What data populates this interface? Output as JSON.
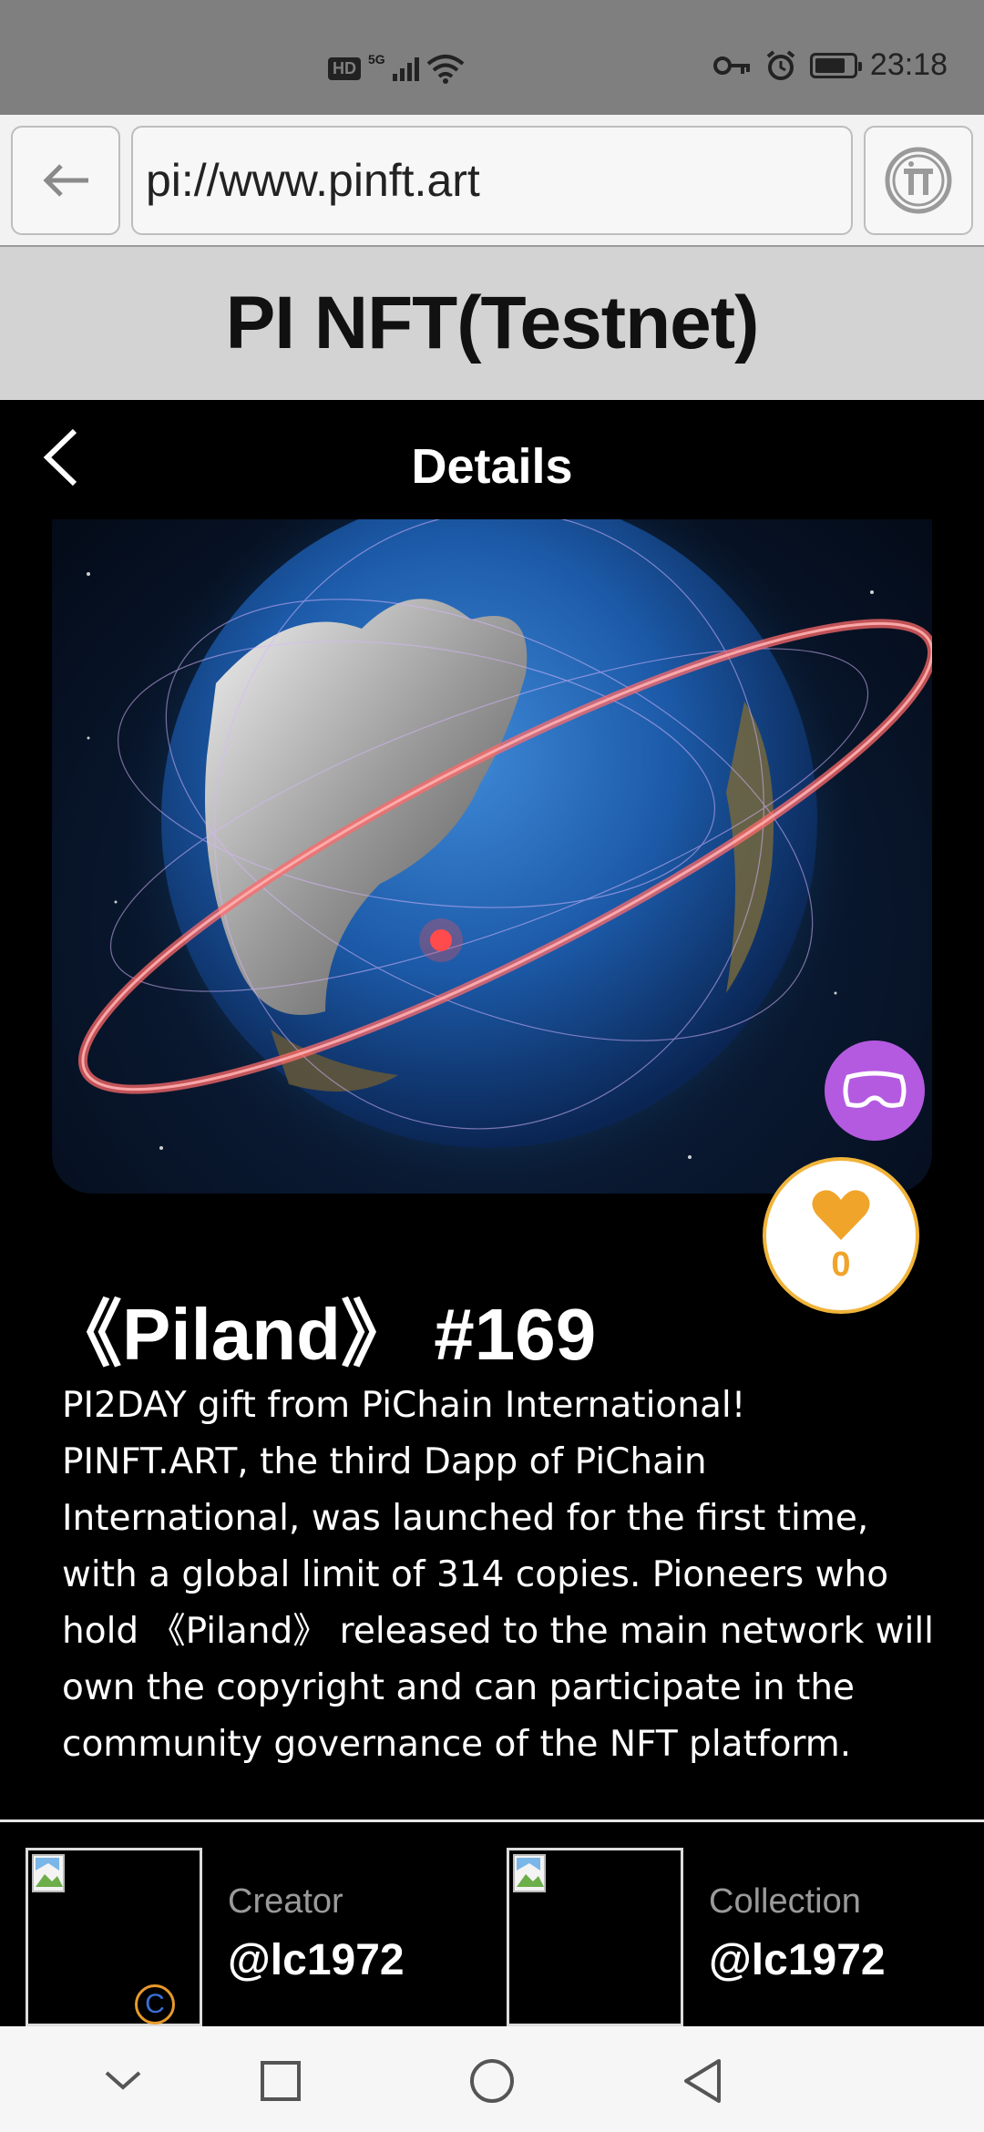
{
  "status_bar": {
    "hd_badge": "HD",
    "signal_label": "5G",
    "time": "23:18",
    "icons": [
      "key-icon",
      "alarm-icon",
      "battery-icon",
      "wifi-icon",
      "signal-icon"
    ]
  },
  "browser": {
    "url": "pi://www.pinft.art"
  },
  "site": {
    "title": "PI NFT(Testnet)"
  },
  "details": {
    "title": "Details"
  },
  "nft": {
    "title": "《Piland》 #169",
    "description": "PI2DAY gift from PiChain International! PINFT.ART, the third Dapp of PiChain International, was launched for the first time, with a global limit of 314 copies. Pioneers who hold 《Piland》 released to the main network will own the copyright and can participate in the community governance of the NFT platform.",
    "likes": "0"
  },
  "creator": {
    "label": "Creator",
    "value": "@lc1972",
    "badge": "C"
  },
  "collection": {
    "label": "Collection",
    "value": "@lc1972"
  },
  "colors": {
    "vr_button": "#b45ae0",
    "like_accent": "#f0a42a",
    "site_header_bg": "#d3d3d3",
    "status_bar_bg": "#7f7f7f"
  }
}
